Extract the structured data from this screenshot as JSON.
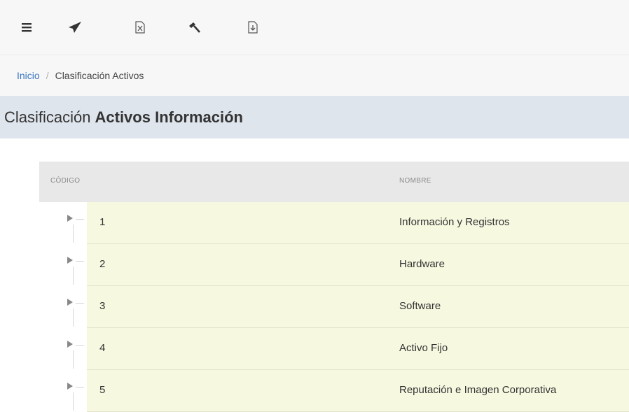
{
  "toolbar": {
    "buttons": [
      {
        "icon": "menu-icon"
      },
      {
        "icon": "send-icon"
      },
      {
        "icon": "excel-export-icon"
      },
      {
        "icon": "hammer-icon"
      },
      {
        "icon": "pdf-export-icon"
      }
    ]
  },
  "breadcrumb": {
    "home": "Inicio",
    "separator": "/",
    "current": "Clasificación Activos"
  },
  "page_title": {
    "prefix": "Clasificación",
    "bold": "Activos Información"
  },
  "table": {
    "columns": [
      "CÓDIGO",
      "NOMBRE"
    ],
    "rows": [
      {
        "code": "1",
        "name": "Información y Registros"
      },
      {
        "code": "2",
        "name": "Hardware"
      },
      {
        "code": "3",
        "name": "Software"
      },
      {
        "code": "4",
        "name": "Activo Fijo"
      },
      {
        "code": "5",
        "name": "Reputación e Imagen Corporativa"
      }
    ]
  },
  "colors": {
    "row_bg": "#f7f8e0",
    "title_bg": "#dfe5ed",
    "link": "#3c78c3"
  }
}
